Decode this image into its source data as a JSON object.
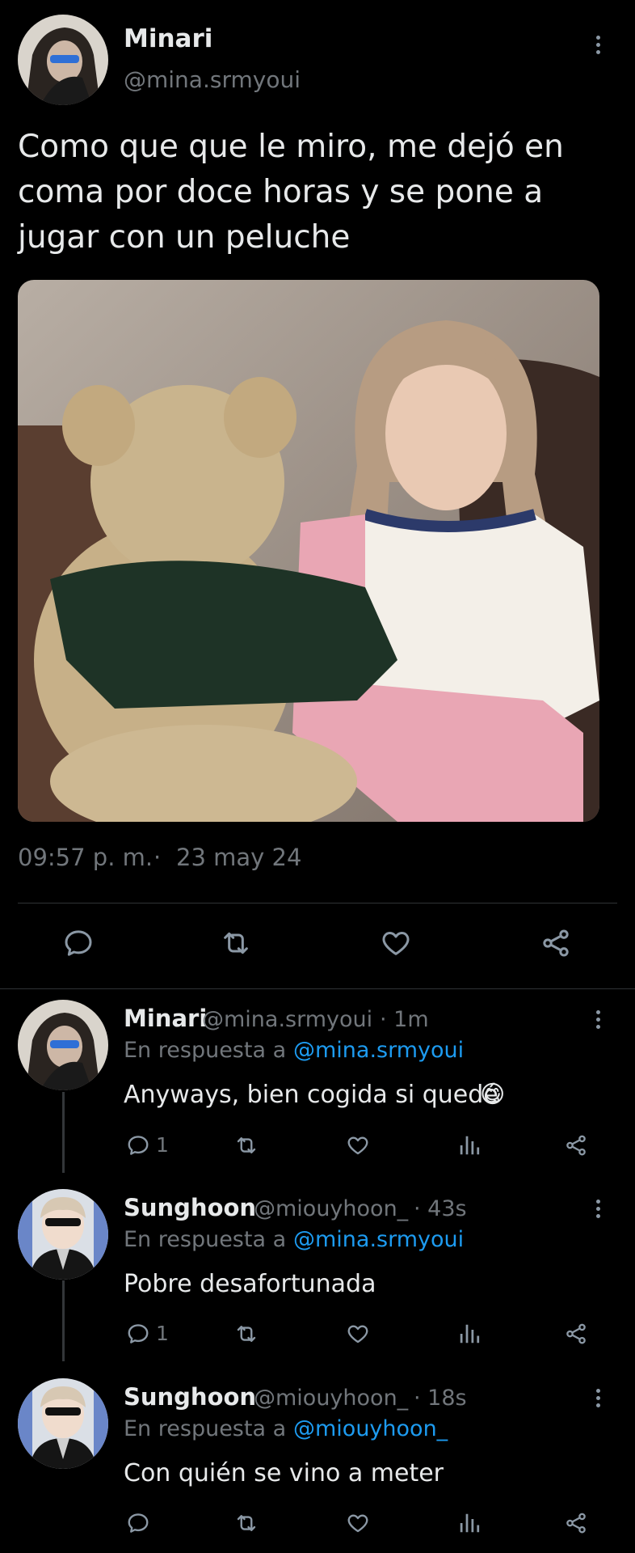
{
  "main_tweet": {
    "author_name": "Minari",
    "author_handle": "@mina.srmyoui",
    "text": "Como que que le miro, me dejó en coma por doce horas y se pone a jugar con un peluche",
    "time": "09:57 p. m.",
    "separator": "·",
    "date": "23 may 24"
  },
  "replies": [
    {
      "author_name": "Minari",
      "author_handle": "@mina.srmyoui",
      "time": "· 1m",
      "reply_prefix": "En respuesta a",
      "reply_to": "@mina.srmyoui",
      "text": "Anyways, bien cogida si quedé",
      "emoji": "😋",
      "reply_count": "1"
    },
    {
      "author_name": "Sunghoon",
      "author_handle": "@miouyhoon_",
      "time": "· 43s",
      "reply_prefix": "En respuesta a",
      "reply_to": "@mina.srmyoui",
      "text": "Pobre desafortunada",
      "reply_count": "1"
    },
    {
      "author_name": "Sunghoon",
      "author_handle": "@miouyhoon_",
      "time": "· 18s",
      "reply_prefix": "En respuesta a",
      "reply_to": "@miouyhoon_",
      "text": "Con quién se vino a meter",
      "reply_count": ""
    }
  ],
  "colors": {
    "background": "#000000",
    "text": "#e7e9ea",
    "muted": "#71767b",
    "link": "#1d9bf0",
    "divider": "#2f3336"
  },
  "icons": [
    "more-icon",
    "reply-icon",
    "retweet-icon",
    "like-icon",
    "share-icon",
    "views-icon"
  ]
}
